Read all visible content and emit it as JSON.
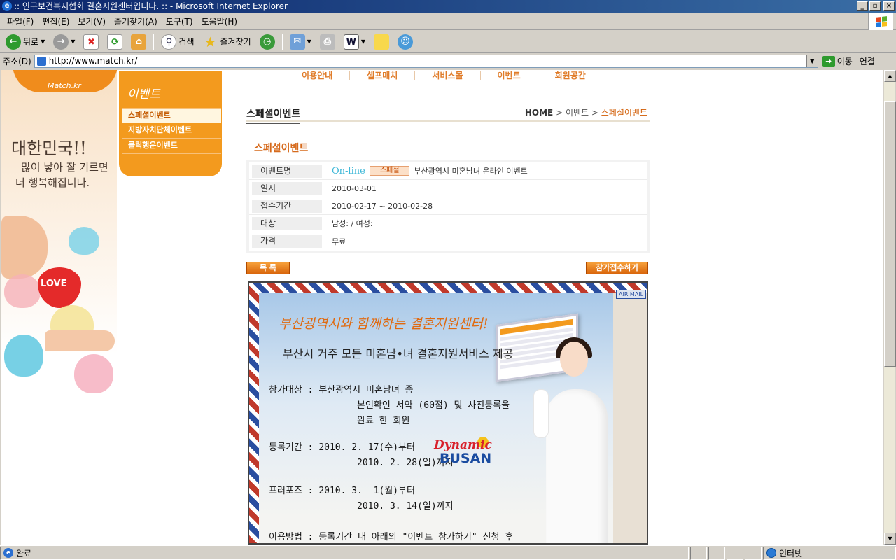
{
  "window": {
    "title": ":: 인구보건복지협회 결혼지원센터입니다. :: - Microsoft Internet Explorer",
    "controls": {
      "minimize": "_",
      "maximize": "▫",
      "close": "×"
    }
  },
  "menu": [
    "파일(F)",
    "편집(E)",
    "보기(V)",
    "즐겨찾기(A)",
    "도구(T)",
    "도움말(H)"
  ],
  "toolbar": {
    "back": "뒤로",
    "search": "검색",
    "favorites": "즐겨찾기"
  },
  "address": {
    "label": "주소(D)",
    "url": "http://www.match.kr/",
    "go": "이동",
    "links": "연결"
  },
  "status": {
    "text": "완료",
    "zone": "인터넷"
  },
  "site": {
    "logo_text": "Match.kr",
    "slogan_line1": "대한민국!!",
    "slogan_line2": "많이 낳아 잘 기르면",
    "slogan_line3": "더 행복해집니다.",
    "love": "LOVE",
    "top_nav": [
      "이용안내",
      "셀프매치",
      "서비스몰",
      "이벤트",
      "회원공간"
    ],
    "sub_nav_title": "이벤트",
    "sub_nav": [
      "스페셜이벤트",
      "지방자치단체이벤트",
      "클릭행운이벤트"
    ],
    "page_title": "스페셜이벤트",
    "breadcrumb": {
      "home": "HOME",
      "sep1": " > ",
      "level1": "이벤트",
      "sep2": " > ",
      "current": "스페셜이벤트"
    },
    "section_title": "스페셜이벤트",
    "info": {
      "event_name_label": "이벤트명",
      "online": "On-line",
      "tag": "스페셜",
      "event_name": "부산광역시 미혼남녀 온라인 이벤트",
      "date_label": "일시",
      "date": "2010-03-01",
      "period_label": "접수기간",
      "period": "2010-02-17 ~ 2010-02-28",
      "target_label": "대상",
      "target": "남성: / 여성:",
      "price_label": "가격",
      "price": "무료"
    },
    "buttons": {
      "list": "목 록",
      "join": "참가접수하기"
    },
    "poster": {
      "airmail": "AIR MAIL",
      "title": "부산광역시와 함께하는 결혼지원센터!",
      "subtitle": "부산시 거주 모든 미혼남•녀 결혼지원서비스 제공",
      "line1": "참가대상 : 부산광역시 미혼남녀 중",
      "line2": "본인확인 서약 (60점) 및 사진등록을",
      "line3": "완료 한 회원",
      "line4": "등록기간 : 2010. 2. 17(수)부터",
      "line5": "2010. 2. 28(일)까지",
      "line6": "프러포즈 : 2010. 3.  1(월)부터",
      "line7": "2010. 3. 14(일)까지",
      "line8": "이용방법 : 등록기간 내 아래의 \"이벤트 참가하기\" 신청 후",
      "brand1": "Dynamic",
      "brand2": "BUSAN"
    }
  }
}
